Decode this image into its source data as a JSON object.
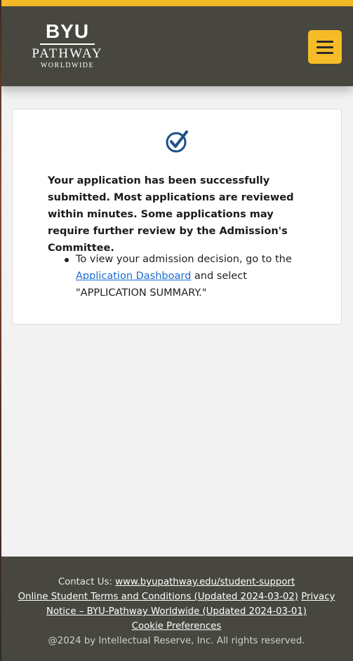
{
  "header": {
    "logo": {
      "line1": "BYU",
      "line2": "PATHWAY",
      "line3": "WORLDWIDE"
    },
    "menu_icon": "hamburger-menu-icon"
  },
  "colors": {
    "accent": "#f6bc28",
    "header_bg": "#47463f",
    "link": "#1a6bd1",
    "check_icon": "#1f4f8a"
  },
  "confirmation": {
    "icon": "check-circle-icon",
    "message": "Your application has been successfully submitted. Most applications are reviewed within minutes. Some applications may require further review by the Admission's Committee.",
    "instruction": {
      "before_link": "To view your admission decision, go to the ",
      "link_text": "Application Dashboard",
      "after_link": " and select \"APPLICATION SUMMARY.\""
    }
  },
  "footer": {
    "contact_label": "Contact Us: ",
    "contact_link": "www.byupathway.edu/student-support",
    "terms_link": "Online Student Terms and Conditions (Updated 2024-03-02)",
    "privacy_link": "Privacy Notice – BYU-Pathway Worldwide (Updated 2024-03-01)",
    "cookie_link": "Cookie Preferences",
    "copyright": "@2024 by Intellectual Reserve, Inc. All rights reserved."
  }
}
